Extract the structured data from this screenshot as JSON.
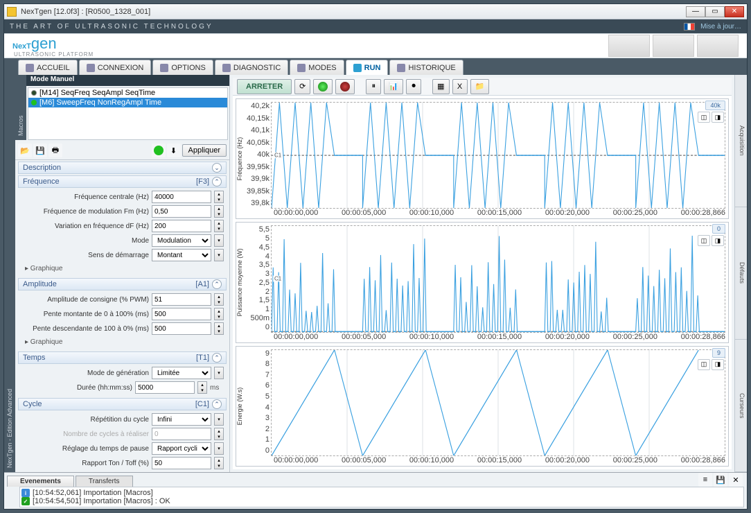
{
  "window": {
    "title": "NexTgen [12.0f3] : [R0500_1328_001]"
  },
  "tagline": "THE ART OF ULTRASONIC TECHNOLOGY",
  "update_link": "Mise à jour…",
  "logo": {
    "main": "NexTgen",
    "sub": "ULTRASONIC PLATFORM"
  },
  "tabs": [
    "ACCUEIL",
    "CONNEXION",
    "OPTIONS",
    "DIAGNOSTIC",
    "MODES",
    "RUN",
    "HISTORIQUE"
  ],
  "active_tab": "RUN",
  "left_rail": "Macros",
  "edition_rail": "NexTgen - Edition Advanced",
  "mode_header": "Mode Manuel",
  "macros": [
    {
      "label": "[M14] SeqFreq SeqAmpl SeqTime",
      "sel": false
    },
    {
      "label": "[M6] SweepFreq NonRegAmpl Time",
      "sel": true
    }
  ],
  "apply_label": "Appliquer",
  "sections": {
    "description": {
      "title": "Description"
    },
    "frequence": {
      "title": "Fréquence",
      "shortcut": "[F3]",
      "rows": [
        {
          "label": "Fréquence centrale (Hz)",
          "value": "40000",
          "type": "spin"
        },
        {
          "label": "Fréquence de modulation Fm (Hz)",
          "value": "0,50",
          "type": "spin"
        },
        {
          "label": "Variation en fréquence dF (Hz)",
          "value": "200",
          "type": "spin"
        },
        {
          "label": "Mode",
          "value": "Modulation",
          "type": "select"
        },
        {
          "label": "Sens de démarrage",
          "value": "Montant",
          "type": "select"
        }
      ],
      "sub": "Graphique"
    },
    "amplitude": {
      "title": "Amplitude",
      "shortcut": "[A1]",
      "rows": [
        {
          "label": "Amplitude de consigne (% PWM)",
          "value": "51",
          "type": "spin"
        },
        {
          "label": "Pente montante de 0 à 100% (ms)",
          "value": "500",
          "type": "spin"
        },
        {
          "label": "Pente descendante de 100 à 0% (ms)",
          "value": "500",
          "type": "spin"
        }
      ],
      "sub": "Graphique"
    },
    "temps": {
      "title": "Temps",
      "shortcut": "[T1]",
      "rows": [
        {
          "label": "Mode de génération",
          "value": "Limitée",
          "type": "select"
        },
        {
          "label": "Durée (hh:mm:ss)",
          "value": "5000",
          "type": "spin",
          "unit": "ms"
        }
      ]
    },
    "cycle": {
      "title": "Cycle",
      "shortcut": "[C1]",
      "rows": [
        {
          "label": "Répétition du cycle",
          "value": "Infini",
          "type": "select"
        },
        {
          "label": "Nombre de cycles à réaliser",
          "value": "0",
          "type": "spin",
          "disabled": true
        },
        {
          "label": "Réglage du temps de pause",
          "value": "Rapport cyclique",
          "type": "select"
        },
        {
          "label": "Rapport Ton / Toff (%)",
          "value": "50",
          "type": "spin"
        }
      ]
    }
  },
  "chart_toolbar": {
    "stop": "ARRETER"
  },
  "charts": {
    "xticks": [
      "00:00:00,000",
      "00:00:05,000",
      "00:00:10,000",
      "00:00:15,000",
      "00:00:20,000",
      "00:00:25,000",
      "00:00:28,866"
    ],
    "freq": {
      "ylabel": "Fréquence (Hz)",
      "yticks": [
        "40,2k",
        "40,15k",
        "40,1k",
        "40,05k",
        "40k",
        "39,95k",
        "39,9k",
        "39,85k",
        "39,8k"
      ],
      "badge": "40k",
      "cursor": "C1"
    },
    "power": {
      "ylabel": "Puissance moyenne (W)",
      "yticks": [
        "5,5",
        "5",
        "4,5",
        "4",
        "3,5",
        "3",
        "2,5",
        "2",
        "1,5",
        "1",
        "500m",
        "0"
      ],
      "badge": "0",
      "cursor": "C1"
    },
    "energy": {
      "ylabel": "Energie (W.s)",
      "yticks": [
        "9",
        "8",
        "7",
        "6",
        "5",
        "4",
        "3",
        "2",
        "1",
        "0"
      ],
      "badge": "9"
    }
  },
  "right_tabs": [
    "Acquisition",
    "Défauts",
    "Curseurs"
  ],
  "bottom_tabs": [
    "Evenements",
    "Transferts"
  ],
  "log": [
    {
      "type": "info",
      "text": "[10:54:52,061]  Importation [Macros]"
    },
    {
      "type": "ok",
      "text": "[10:54:54,501]  Importation [Macros] : OK"
    }
  ],
  "chart_data": [
    {
      "type": "line",
      "title": "Fréquence (Hz)",
      "x_range": [
        0,
        28.866
      ],
      "y_range": [
        39800,
        40200
      ],
      "description": "Triangular frequency modulation centered at 40000 Hz, amplitude ±200 Hz, modulation rate 0.5 Hz, active in 5 bursts (~4s each) with ~2s pauses at 40000 Hz between bursts",
      "series": [
        {
          "name": "Fréquence",
          "pattern": "triangular_bursts",
          "center": 40000,
          "delta": 200,
          "fm_hz": 0.5,
          "bursts": [
            [
              0,
              4
            ],
            [
              5.8,
              9.8
            ],
            [
              11.6,
              15.6
            ],
            [
              17.4,
              21.4
            ],
            [
              23.2,
              27.2
            ]
          ]
        }
      ]
    },
    {
      "type": "line",
      "title": "Puissance moyenne (W)",
      "x_range": [
        0,
        28.866
      ],
      "y_range": [
        0,
        5.5
      ],
      "description": "Spiky power peaks ~0.5–5 W during active bursts, near 0 during pauses, 5 burst groups",
      "series": [
        {
          "name": "Puissance",
          "pattern": "spiky_bursts",
          "peak_range": [
            0.5,
            5.2
          ],
          "baseline": 0,
          "bursts": [
            [
              0,
              4
            ],
            [
              5.8,
              9.8
            ],
            [
              11.6,
              15.6
            ],
            [
              17.4,
              21.4
            ],
            [
              23.2,
              27.2
            ]
          ]
        }
      ]
    },
    {
      "type": "line",
      "title": "Energie (W.s)",
      "x_range": [
        0,
        28.866
      ],
      "y_range": [
        0,
        9
      ],
      "description": "Cumulative energy rising stepwise to ~9 W·s within each burst then resetting to 0 at burst start; 5 sawtooth ramps",
      "series": [
        {
          "name": "Energie",
          "pattern": "sawtooth_ramps",
          "max": 9,
          "reset": 0,
          "bursts": [
            [
              0,
              4
            ],
            [
              5.8,
              9.8
            ],
            [
              11.6,
              15.6
            ],
            [
              17.4,
              21.4
            ],
            [
              23.2,
              27.2
            ]
          ]
        }
      ]
    }
  ]
}
